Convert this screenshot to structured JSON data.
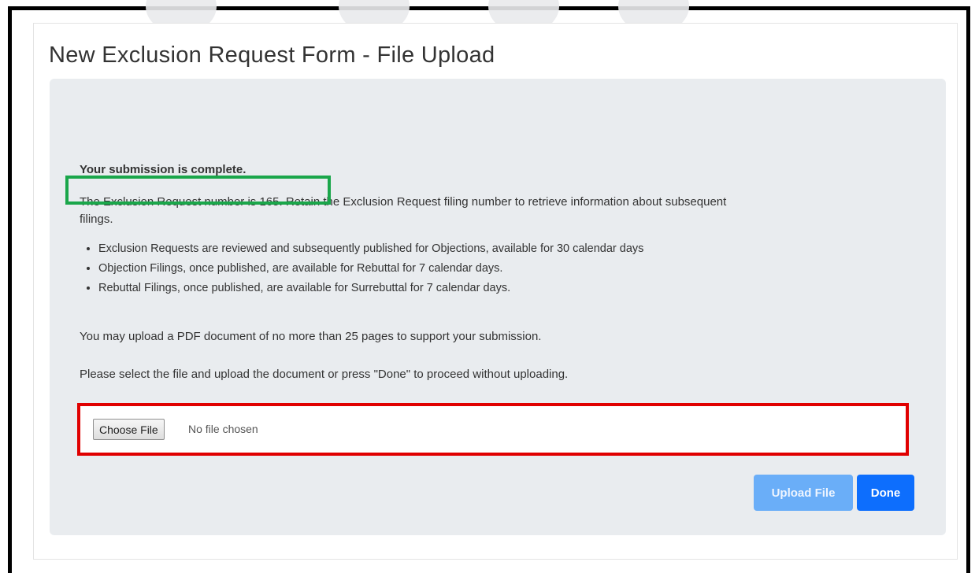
{
  "page": {
    "title": "New Exclusion Request Form - File Upload"
  },
  "confirmation": {
    "heading": "Your submission is complete.",
    "request_number_text": "The Exclusion Request number is 165.",
    "request_number": 165,
    "retain_text_line1": "Retain the Exclusion Request filing number to retrieve information about subsequent",
    "retain_text_line2": "filings."
  },
  "bullets": [
    "Exclusion Requests are reviewed and subsequently published for Objections, available for 30 calendar days",
    "Objection Filings, once published, are available for Rebuttal for 7 calendar days.",
    "Rebuttal Filings, once published, are available for Surrebuttal for 7 calendar days."
  ],
  "instructions": {
    "upload_limit": "You may upload a PDF document of no more than 25 pages to support your submission.",
    "select_prompt": "Please select the file and upload the document or press \"Done\" to proceed without uploading."
  },
  "file_input": {
    "button_label": "Choose File",
    "status": "No file chosen"
  },
  "actions": {
    "upload_label": "Upload File",
    "done_label": "Done"
  },
  "colors": {
    "highlight_green": "#1aa64a",
    "highlight_red": "#e00000",
    "primary_button": "#0d6efd",
    "disabled_button": "#6aaef8",
    "panel_background": "#e9ecef"
  }
}
